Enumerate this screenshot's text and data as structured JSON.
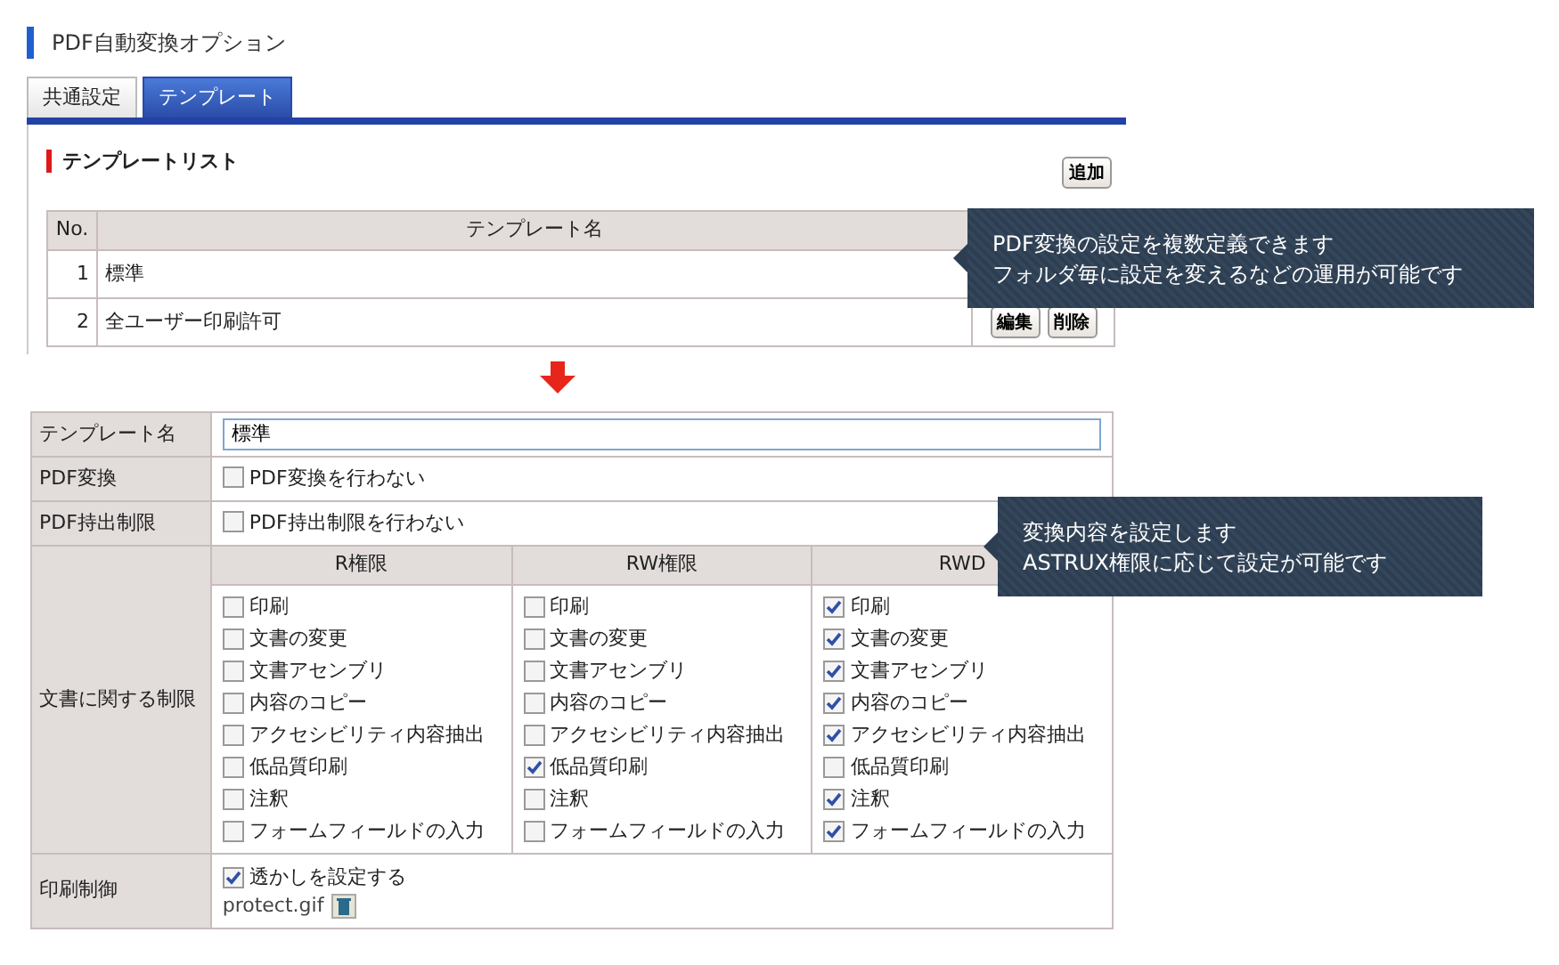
{
  "title": "PDF自動変換オプション",
  "tabs": [
    {
      "label": "共通設定",
      "selected": false
    },
    {
      "label": "テンプレート",
      "selected": true
    }
  ],
  "template_list": {
    "heading": "テンプレートリスト",
    "add_button": "追加",
    "columns": [
      "No.",
      "テンプレート名"
    ],
    "rows": [
      {
        "no": "1",
        "name": "標準",
        "actions": []
      },
      {
        "no": "2",
        "name": "全ユーザー印刷許可",
        "actions": [
          "編集",
          "削除"
        ]
      }
    ]
  },
  "form": {
    "name_label": "テンプレート名",
    "name_value": "標準",
    "pdf_convert": {
      "label": "PDF変換",
      "option": {
        "text": "PDF変換を行わない",
        "checked": false
      }
    },
    "pdf_export": {
      "label": "PDF持出制限",
      "option": {
        "text": "PDF持出制限を行わない",
        "checked": false
      }
    },
    "restrictions": {
      "label": "文書に関する制限",
      "columns": [
        {
          "header": "R権限",
          "items": [
            {
              "text": "印刷",
              "checked": false
            },
            {
              "text": "文書の変更",
              "checked": false
            },
            {
              "text": "文書アセンブリ",
              "checked": false
            },
            {
              "text": "内容のコピー",
              "checked": false
            },
            {
              "text": "アクセシビリティ内容抽出",
              "checked": false
            },
            {
              "text": "低品質印刷",
              "checked": false
            },
            {
              "text": "注釈",
              "checked": false
            },
            {
              "text": "フォームフィールドの入力",
              "checked": false
            }
          ]
        },
        {
          "header": "RW権限",
          "items": [
            {
              "text": "印刷",
              "checked": false
            },
            {
              "text": "文書の変更",
              "checked": false
            },
            {
              "text": "文書アセンブリ",
              "checked": false
            },
            {
              "text": "内容のコピー",
              "checked": false
            },
            {
              "text": "アクセシビリティ内容抽出",
              "checked": false
            },
            {
              "text": "低品質印刷",
              "checked": true
            },
            {
              "text": "注釈",
              "checked": false
            },
            {
              "text": "フォームフィールドの入力",
              "checked": false
            }
          ]
        },
        {
          "header": "RWD",
          "items": [
            {
              "text": "印刷",
              "checked": true
            },
            {
              "text": "文書の変更",
              "checked": true
            },
            {
              "text": "文書アセンブリ",
              "checked": true
            },
            {
              "text": "内容のコピー",
              "checked": true
            },
            {
              "text": "アクセシビリティ内容抽出",
              "checked": true
            },
            {
              "text": "低品質印刷",
              "checked": false
            },
            {
              "text": "注釈",
              "checked": true
            },
            {
              "text": "フォームフィールドの入力",
              "checked": true
            }
          ]
        }
      ]
    },
    "print_control": {
      "label": "印刷制御",
      "watermark": {
        "text": "透かしを設定する",
        "checked": true
      },
      "file": "protect.gif"
    }
  },
  "callouts": [
    {
      "lines": [
        "PDF変換の設定を複数定義できます",
        "フォルダ毎に設定を変えるなどの運用が可能です"
      ]
    },
    {
      "lines": [
        "変換内容を設定します",
        "ASTRUX権限に応じて設定が可能です"
      ]
    }
  ]
}
